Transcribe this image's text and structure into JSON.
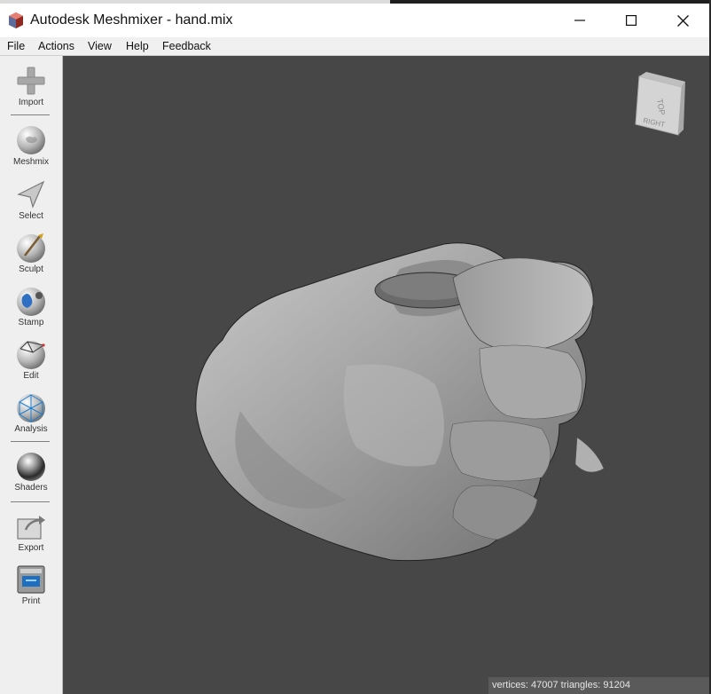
{
  "window": {
    "title": "Autodesk Meshmixer - hand.mix",
    "icon": "meshmixer-logo-icon",
    "controls": [
      "minimize-icon",
      "maximize-icon",
      "close-icon"
    ]
  },
  "menu": {
    "file": "File",
    "actions": "Actions",
    "view": "View",
    "help": "Help",
    "feedback": "Feedback"
  },
  "toolbar": {
    "import": "Import",
    "meshmix": "Meshmix",
    "select": "Select",
    "sculpt": "Sculpt",
    "stamp": "Stamp",
    "edit": "Edit",
    "analysis": "Analysis",
    "shaders": "Shaders",
    "export": "Export",
    "print": "Print"
  },
  "viewcube": {
    "top": "TOP",
    "right": "RIGHT"
  },
  "status": {
    "text": "vertices: 47007 triangles: 91204"
  },
  "colors": {
    "viewport": "#474747",
    "toolbar": "#efefef",
    "status_bar": "#5a5a5a",
    "model": "#9a9a9a"
  }
}
